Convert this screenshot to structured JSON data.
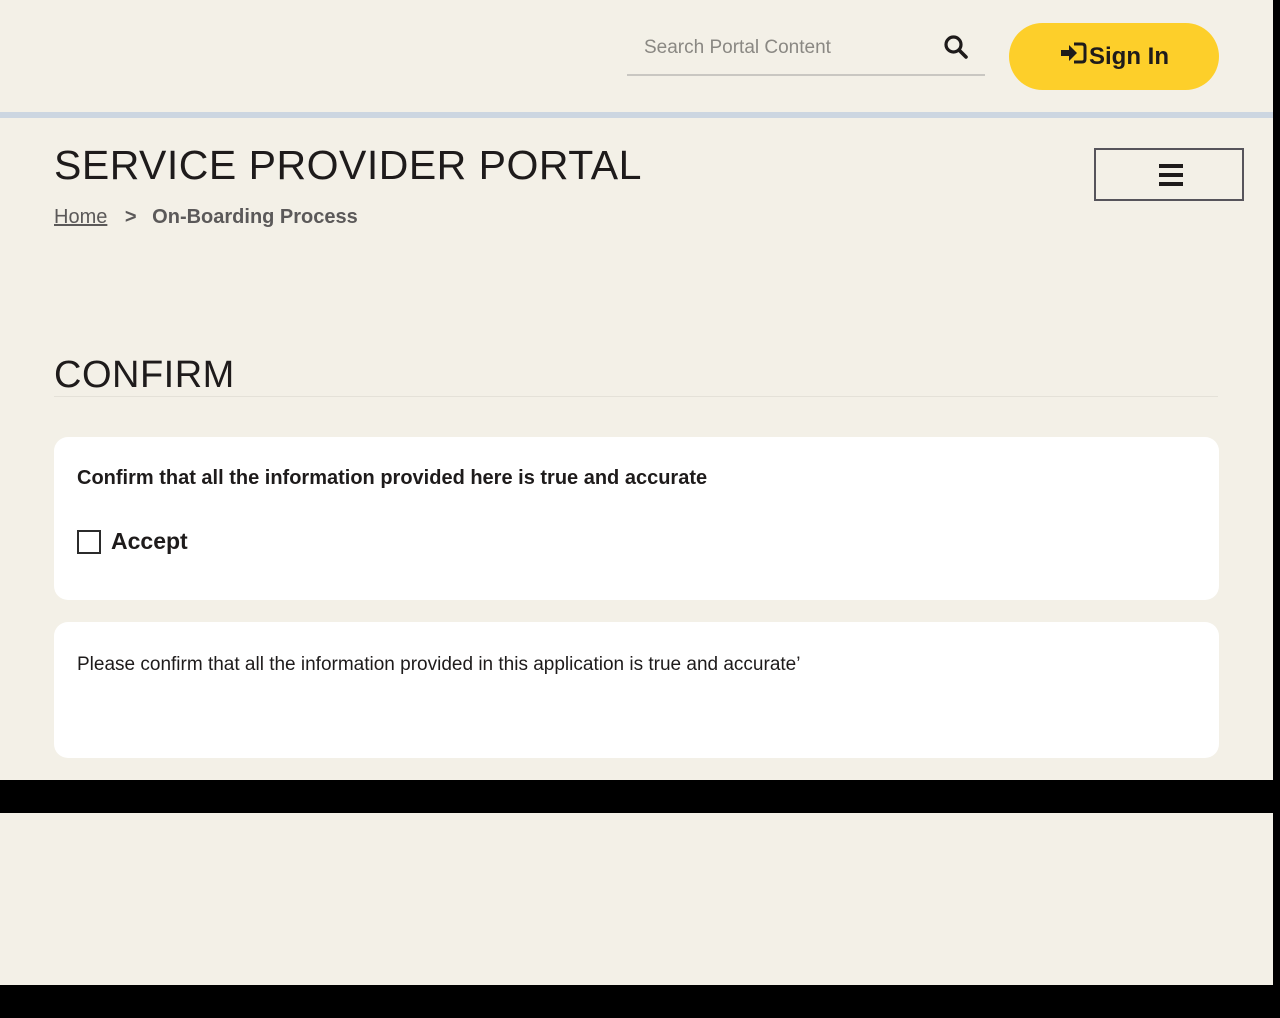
{
  "header": {
    "search_placeholder": "Search Portal Content",
    "search_icon": "search-icon",
    "signin_label": "Sign In",
    "signin_icon": "sign-in-icon",
    "accent_color": "#fdcf2a"
  },
  "portal": {
    "title": "SERVICE PROVIDER PORTAL",
    "menu_icon": "hamburger-icon"
  },
  "breadcrumb": {
    "home": "Home",
    "separator": ">",
    "current": "On-Boarding Process"
  },
  "section": {
    "title": "CONFIRM"
  },
  "confirm_card": {
    "label": "Confirm that all the information provided here is true and accurate",
    "checkbox_label": "Accept",
    "checked": false
  },
  "info_card": {
    "text": "Please confirm that all the information provided in this application is true and accurate’"
  }
}
